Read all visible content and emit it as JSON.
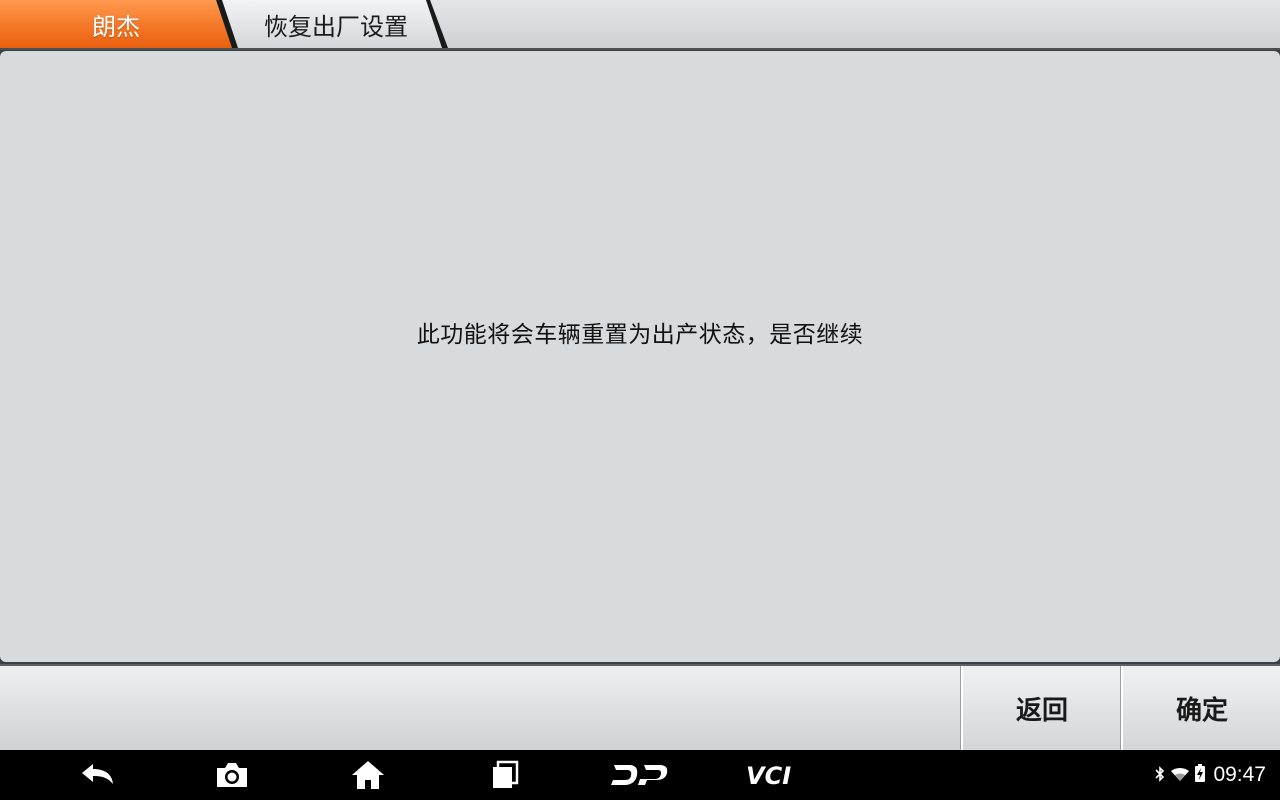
{
  "header": {
    "breadcrumbs": [
      {
        "label": "朗杰"
      },
      {
        "label": "恢复出厂设置"
      }
    ]
  },
  "dialog": {
    "message": "此功能将会车辆重置为出产状态，是否继续"
  },
  "actions": {
    "back_label": "返回",
    "ok_label": "确定"
  },
  "navbar": {
    "icons": [
      "back-icon",
      "camera-icon",
      "home-icon",
      "recent-apps-icon",
      "dp-icon",
      "vci-icon"
    ],
    "dp_label": "DP",
    "vci_label": "VCI"
  },
  "status_bar": {
    "time": "09:47",
    "icons": [
      "bluetooth-icon",
      "wifi-icon",
      "battery-icon"
    ]
  },
  "colors": {
    "accent": "#f26a1b",
    "panel": "#d8dbde",
    "navbar": "#000000"
  }
}
